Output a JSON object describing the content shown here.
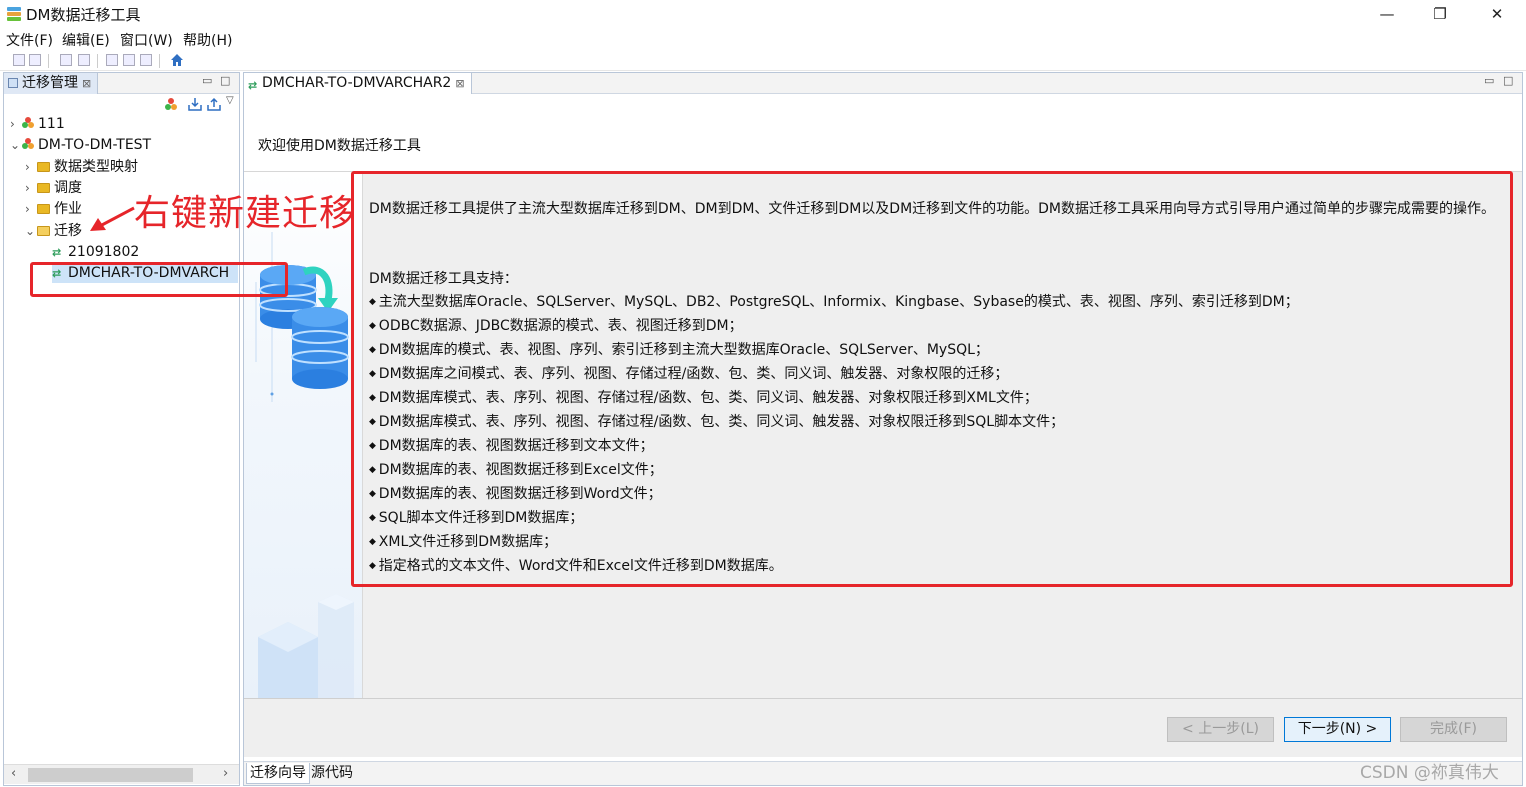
{
  "window": {
    "title": "DM数据迁移工具",
    "controls": {
      "minimize": "—",
      "restore": "❐",
      "close": "✕"
    }
  },
  "menu": [
    "文件(F)",
    "编辑(E)",
    "窗口(W)",
    "帮助(H)"
  ],
  "left_panel": {
    "tab_title": "迁移管理",
    "tab_close": "⊠",
    "tree": [
      {
        "label": "111",
        "expanded": false,
        "type": "project"
      },
      {
        "label": "DM-TO-DM-TEST",
        "expanded": true,
        "type": "project"
      },
      {
        "label": "数据类型映射",
        "type": "folder"
      },
      {
        "label": "调度",
        "type": "folder"
      },
      {
        "label": "作业",
        "type": "folder"
      },
      {
        "label": "迁移",
        "type": "folder-open"
      },
      {
        "label": "21091802",
        "type": "migration"
      },
      {
        "label": "DMCHAR-TO-DMVARCH",
        "type": "migration",
        "selected": true
      }
    ]
  },
  "annotation": {
    "text": "右键新建迁移",
    "color": "#e6252a"
  },
  "editor": {
    "tab_title": "DMCHAR-TO-DMVARCHAR2",
    "tab_close": "⊠",
    "welcome": "欢迎使用DM数据迁移工具",
    "intro": "DM数据迁移工具提供了主流大型数据库迁移到DM、DM到DM、文件迁移到DM以及DM迁移到文件的功能。DM数据迁移工具采用向导方式引导用户通过简单的步骤完成需要的操作。",
    "support_title": "DM数据迁移工具支持：",
    "support_items": [
      "主流大型数据库Oracle、SQLServer、MySQL、DB2、PostgreSQL、Informix、Kingbase、Sybase的模式、表、视图、序列、索引迁移到DM；",
      "ODBC数据源、JDBC数据源的模式、表、视图迁移到DM；",
      "DM数据库的模式、表、视图、序列、索引迁移到主流大型数据库Oracle、SQLServer、MySQL；",
      "DM数据库之间模式、表、序列、视图、存储过程/函数、包、类、同义词、触发器、对象权限的迁移；",
      "DM数据库模式、表、序列、视图、存储过程/函数、包、类、同义词、触发器、对象权限迁移到XML文件；",
      "DM数据库模式、表、序列、视图、存储过程/函数、包、类、同义词、触发器、对象权限迁移到SQL脚本文件；",
      "DM数据库的表、视图数据迁移到文本文件；",
      "DM数据库的表、视图数据迁移到Excel文件；",
      "DM数据库的表、视图数据迁移到Word文件；",
      "SQL脚本文件迁移到DM数据库；",
      "XML文件迁移到DM数据库；",
      "指定格式的文本文件、Word文件和Excel文件迁移到DM数据库。"
    ],
    "buttons": {
      "prev": "< 上一步(L)",
      "next": "下一步(N) >",
      "finish": "完成(F)"
    },
    "bottom_tabs": [
      "迁移向导",
      "源代码"
    ]
  },
  "watermark": "CSDN @祢真伟大"
}
